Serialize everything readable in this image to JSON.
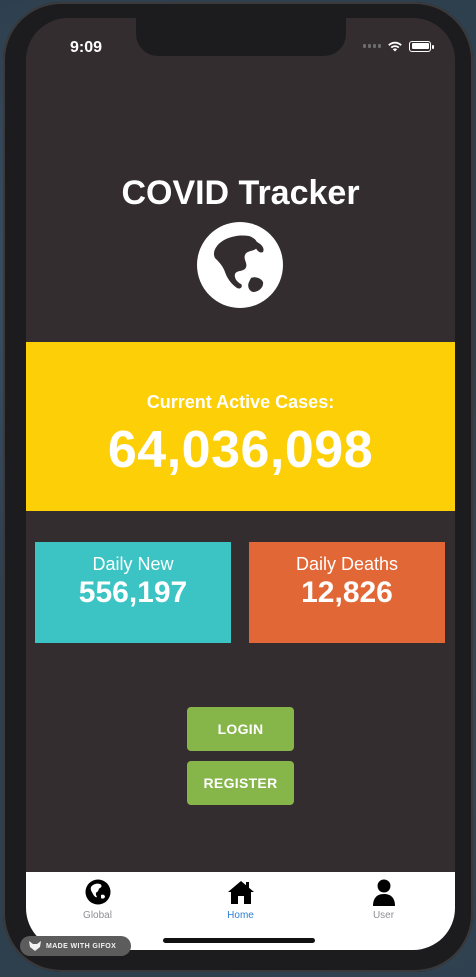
{
  "status_bar": {
    "time": "9:09"
  },
  "app": {
    "title": "COVID Tracker"
  },
  "active_cases": {
    "label": "Current Active Cases:",
    "value": "64,036,098"
  },
  "daily_new": {
    "label": "Daily New",
    "value": "556,197"
  },
  "daily_deaths": {
    "label": "Daily Deaths",
    "value": "12,826"
  },
  "buttons": {
    "login": "LOGIN",
    "register": "REGISTER"
  },
  "tabs": [
    {
      "label": "Global",
      "icon": "globe-icon"
    },
    {
      "label": "Home",
      "icon": "home-icon",
      "active": true
    },
    {
      "label": "User",
      "icon": "user-icon"
    }
  ],
  "watermark": {
    "text": "MADE WITH GIFOX"
  },
  "colors": {
    "background": "#342d2f",
    "active_card": "#fccf06",
    "daily_new_card": "#3cc4c4",
    "daily_deaths_card": "#e26736",
    "button": "#86b54a",
    "active_tab": "#2b7fd6"
  }
}
